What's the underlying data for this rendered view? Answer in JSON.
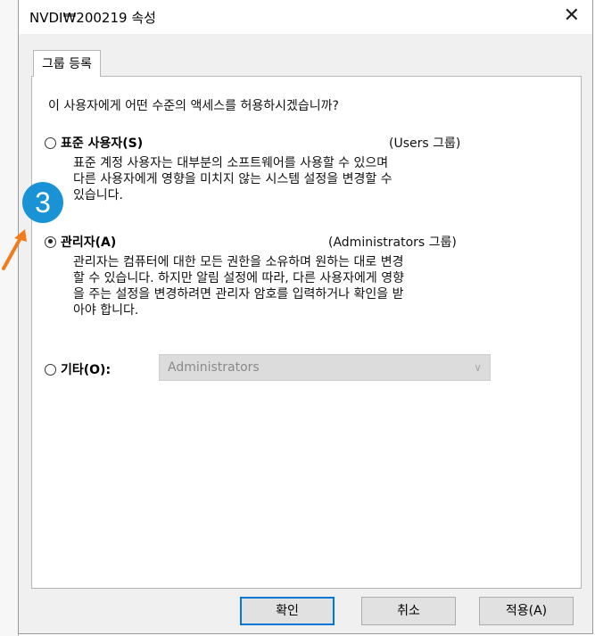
{
  "window": {
    "title": "NVDI₩200219 속성",
    "close_glyph": "✕"
  },
  "tab": {
    "label": "그룹 등록"
  },
  "question": "이 사용자에게 어떤 수준의 액세스를 허용하시겠습니까?",
  "options": [
    {
      "label": "표준 사용자(S)",
      "group": "(Users 그룹)",
      "checked": false,
      "desc_lines": [
        "표준 계정 사용자는 대부분의 소프트웨어를 사용할 수 있으며",
        "다른 사용자에게 영향을 미치지 않는 시스템 설정을 변경할 수",
        "있습니다."
      ]
    },
    {
      "label": "관리자(A)",
      "group": "(Administrators 그룹)",
      "checked": true,
      "desc_lines": [
        "관리자는 컴퓨터에 대한 모든 권한을 소유하며 원하는 대로 변경",
        "할 수 있습니다. 하지만 알림 설정에 따라, 다른 사용자에게 영향",
        "을 주는 설정을 변경하려면 관리자 암호를 입력하거나 확인을 받",
        "아야 합니다."
      ]
    },
    {
      "label": "기타(O):",
      "checked": false,
      "select_value": "Administrators"
    }
  ],
  "buttons": {
    "ok": "확인",
    "cancel": "취소",
    "apply": "적용(A)"
  },
  "annotation": {
    "step": "3",
    "badge_color": "#1a93d6",
    "arrow_color": "#f07c1e"
  }
}
